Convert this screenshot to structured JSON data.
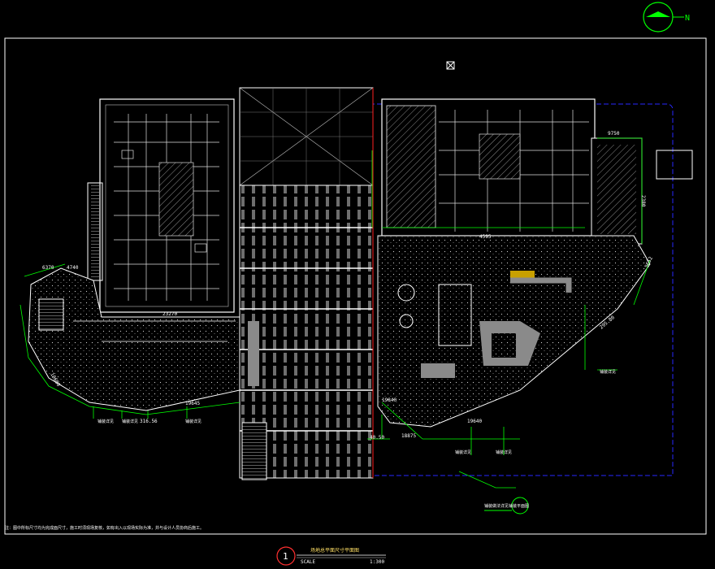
{
  "drawing": {
    "title_block": {
      "number": "1",
      "title": "场地总平面尺寸平面图",
      "scale_label": "SCALE",
      "scale_value": "1:300"
    },
    "note_text": "注：图中所标尺寸均为完成面尺寸，施工时须现场复核，如有出入以现场实际为准，并与设计人员协商后施工。",
    "compass_label": "N",
    "callout_text": "铺装做法详见铺装平面图",
    "dimensions": {
      "left": [
        "6370",
        "4740",
        "10660",
        "19645",
        "23270"
      ],
      "left_bottom": [
        "316.56"
      ],
      "top_small": [
        "9750",
        "2380"
      ],
      "right_side": [
        "19640",
        "4595"
      ],
      "bottom_right": [
        "19840",
        "18875",
        "40.50"
      ],
      "right": [
        "5652",
        "295.80"
      ]
    },
    "tags": {
      "left": [
        "铺装详见",
        "铺装详见",
        "铺装详见"
      ],
      "right": [
        "铺装详见",
        "铺装详见",
        "铺装详见"
      ]
    },
    "colors": {
      "background": "#000000",
      "linework": "#ffffff",
      "dimension": "#00ff00",
      "boundary": "#2828ff",
      "accent": "#ff2020",
      "fill_gray": "#8a8a8a",
      "title_red": "#ff3030",
      "title_text": "#ffe066"
    }
  }
}
